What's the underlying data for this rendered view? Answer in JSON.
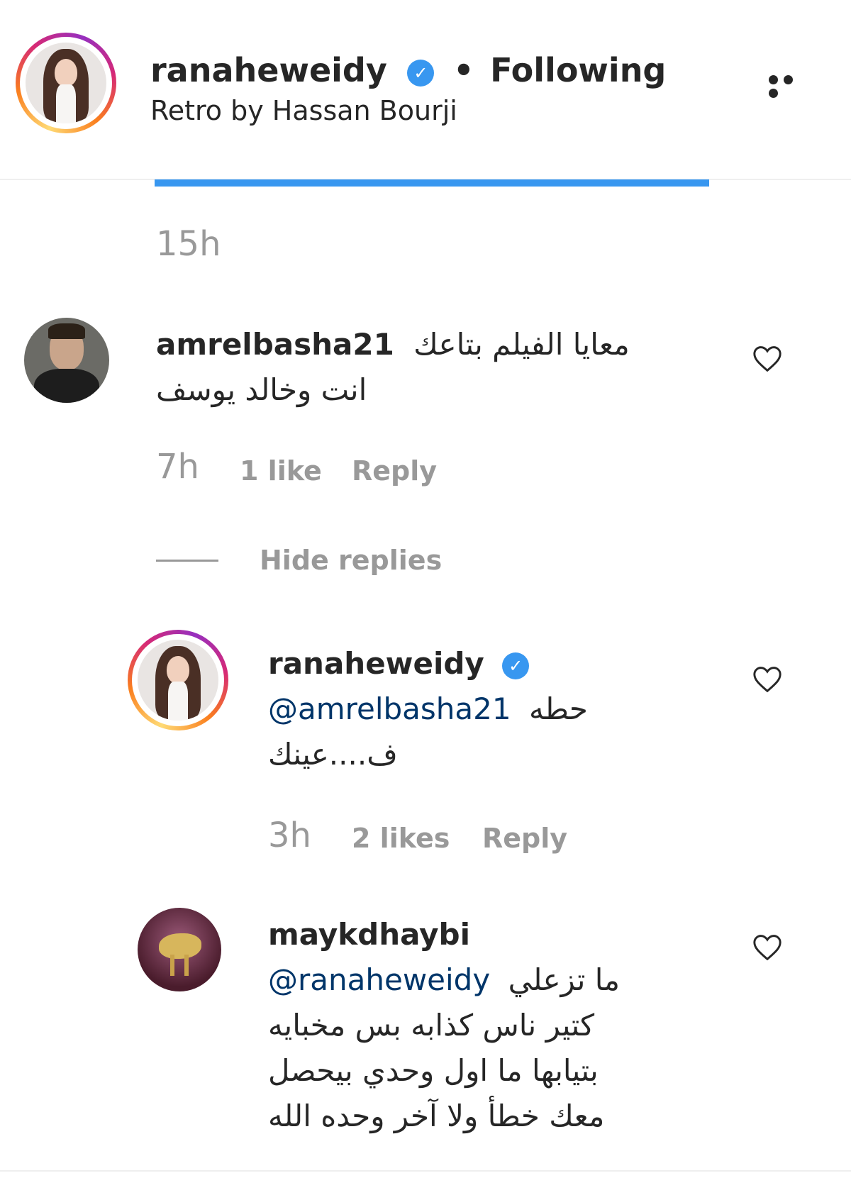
{
  "header": {
    "username": "ranaheweidy",
    "verified_glyph": "✓",
    "separator": "•",
    "follow_status": "Following",
    "subtitle": "Retro by Hassan Bourji",
    "more_icon": "more-horizontal-icon"
  },
  "caption": {
    "time": "15h"
  },
  "comments": [
    {
      "username": "amrelbasha21",
      "text_line1": "معايا الفيلم بتاعك",
      "text_line2": "انت وخالد يوسف",
      "time": "7h",
      "likes": "1 like",
      "reply": "Reply",
      "hide_replies": "Hide replies",
      "replies": [
        {
          "username": "ranaheweidy",
          "verified_glyph": "✓",
          "mention": "@amrelbasha21",
          "text_after_mention": "حطه",
          "text_line2": "ف....عينك",
          "time": "3h",
          "likes": "2 likes",
          "reply": "Reply"
        },
        {
          "username": "maykdhaybi",
          "mention": "@ranaheweidy",
          "text_after_mention": "ما تزعلي",
          "text_line2": "كتير ناس كذابه بس مخبايه",
          "text_line3": "بتيابها ما اول وحدي بيحصل",
          "text_line4": "معك خطأ ولا آخر وحده الله"
        }
      ]
    }
  ],
  "colors": {
    "text": "#262626",
    "muted": "#999999",
    "mention": "#003569",
    "verified": "#3897f0",
    "divider": "#efefef"
  }
}
